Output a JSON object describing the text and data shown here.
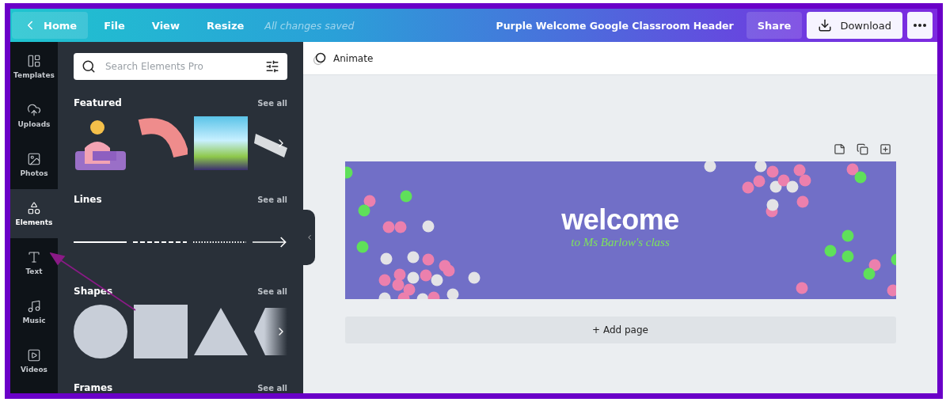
{
  "topbar": {
    "home": "Home",
    "menu": [
      "File",
      "View",
      "Resize"
    ],
    "status": "All changes saved",
    "title": "Purple Welcome Google Classroom Header",
    "share": "Share",
    "download": "Download"
  },
  "rail": [
    {
      "label": "Templates",
      "kind": "templates",
      "selected": false
    },
    {
      "label": "Uploads",
      "kind": "uploads",
      "selected": false
    },
    {
      "label": "Photos",
      "kind": "photos",
      "selected": false
    },
    {
      "label": "Elements",
      "kind": "elements",
      "selected": true
    },
    {
      "label": "Text",
      "kind": "text",
      "selected": false
    },
    {
      "label": "Music",
      "kind": "music",
      "selected": false
    },
    {
      "label": "Videos",
      "kind": "videos",
      "selected": false
    }
  ],
  "panel": {
    "search_placeholder": "Search Elements Pro",
    "sections": [
      {
        "title": "Featured",
        "see_all": "See all",
        "kind": "featured"
      },
      {
        "title": "Lines",
        "see_all": "See all",
        "kind": "lines"
      },
      {
        "title": "Shapes",
        "see_all": "See all",
        "kind": "shapes"
      },
      {
        "title": "Frames",
        "see_all": "See all",
        "kind": "frames"
      }
    ]
  },
  "toolbar": {
    "animate": "Animate"
  },
  "design": {
    "headline": "welcome",
    "subline": "to Ms Barlow's class"
  },
  "add_page": "+ Add page"
}
